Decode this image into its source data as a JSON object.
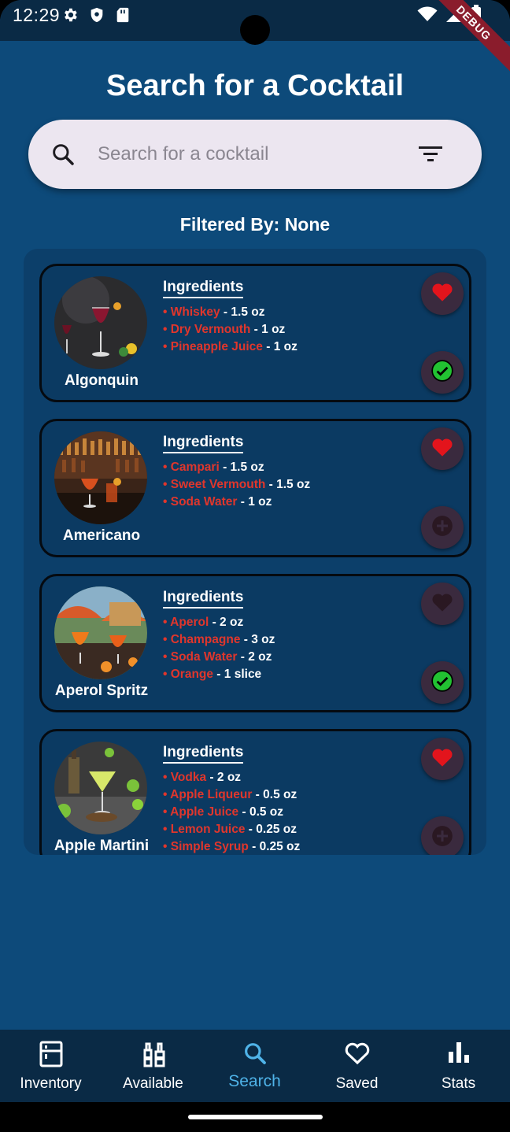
{
  "status_bar": {
    "time": "12:29",
    "debug_label": "DEBUG"
  },
  "page": {
    "title": "Search for a Cocktail",
    "filtered_by": "Filtered By: None"
  },
  "search": {
    "placeholder": "Search for a cocktail",
    "value": ""
  },
  "section_label": "Ingredients",
  "cocktails": [
    {
      "name": "Algonquin",
      "favorited": true,
      "in_stock": true,
      "ingredients": [
        {
          "name": "Whiskey",
          "amount": "1.5 oz"
        },
        {
          "name": "Dry Vermouth",
          "amount": "1 oz"
        },
        {
          "name": "Pineapple Juice",
          "amount": "1 oz"
        }
      ]
    },
    {
      "name": "Americano",
      "favorited": true,
      "in_stock": false,
      "ingredients": [
        {
          "name": "Campari",
          "amount": "1.5 oz"
        },
        {
          "name": "Sweet Vermouth",
          "amount": "1.5 oz"
        },
        {
          "name": "Soda Water",
          "amount": "1 oz"
        }
      ]
    },
    {
      "name": "Aperol Spritz",
      "favorited": false,
      "in_stock": true,
      "ingredients": [
        {
          "name": "Aperol",
          "amount": "2 oz"
        },
        {
          "name": "Champagne",
          "amount": "3 oz"
        },
        {
          "name": "Soda Water",
          "amount": "2 oz"
        },
        {
          "name": "Orange",
          "amount": "1 slice"
        }
      ]
    },
    {
      "name": "Apple Martini",
      "favorited": true,
      "in_stock": false,
      "ingredients": [
        {
          "name": "Vodka",
          "amount": "2 oz"
        },
        {
          "name": "Apple Liqueur",
          "amount": "0.5 oz"
        },
        {
          "name": "Apple Juice",
          "amount": "0.5 oz"
        },
        {
          "name": "Lemon Juice",
          "amount": "0.25 oz"
        },
        {
          "name": "Simple Syrup",
          "amount": "0.25 oz"
        }
      ]
    }
  ],
  "nav": [
    {
      "label": "Inventory",
      "icon": "inventory-icon",
      "active": false
    },
    {
      "label": "Available",
      "icon": "bottles-icon",
      "active": false
    },
    {
      "label": "Search",
      "icon": "search-icon",
      "active": true
    },
    {
      "label": "Saved",
      "icon": "heart-outline-icon",
      "active": false
    },
    {
      "label": "Stats",
      "icon": "bar-chart-icon",
      "active": false
    }
  ],
  "colors": {
    "background": "#0d4a7a",
    "card": "#0b3a62",
    "ingredient_name": "#e0362c",
    "heart_active": "#e3141c",
    "heart_inactive": "#2a1822",
    "check_green": "#22c232",
    "nav_active": "#4fb3e8"
  }
}
